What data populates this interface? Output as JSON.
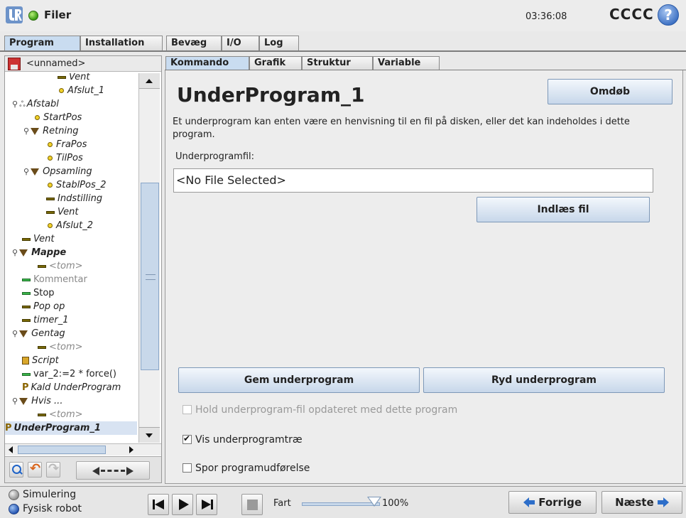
{
  "titlebar": {
    "app_title": "Filer",
    "clock": "03:36:08",
    "robot_name": "CCCC",
    "help_symbol": "?"
  },
  "top_tabs": [
    "Program",
    "Installation",
    "Bevæg",
    "I/O",
    "Log"
  ],
  "program_name": "<unnamed>",
  "tree": [
    {
      "label": "Vent",
      "glyph": "dash"
    },
    {
      "label": "Afslut_1",
      "glyph": "dot"
    },
    {
      "label": "Afstabl",
      "glyph": "stack"
    },
    {
      "label": "StartPos",
      "glyph": "dot"
    },
    {
      "label": "Retning",
      "glyph": "tri"
    },
    {
      "label": "FraPos",
      "glyph": "dot"
    },
    {
      "label": "TilPos",
      "glyph": "dot"
    },
    {
      "label": "Opsamling",
      "glyph": "tri"
    },
    {
      "label": "StablPos_2",
      "glyph": "dot"
    },
    {
      "label": "Indstilling",
      "glyph": "dash"
    },
    {
      "label": "Vent",
      "glyph": "dash"
    },
    {
      "label": "Afslut_2",
      "glyph": "dot"
    },
    {
      "label": "Vent",
      "glyph": "dash"
    },
    {
      "label": "Mappe",
      "glyph": "tri"
    },
    {
      "label": "<tom>",
      "glyph": "dash"
    },
    {
      "label": "Kommentar",
      "glyph": "dash"
    },
    {
      "label": "Stop",
      "glyph": "dash"
    },
    {
      "label": "Pop op",
      "glyph": "dash"
    },
    {
      "label": "timer_1",
      "glyph": "dash"
    },
    {
      "label": "Gentag",
      "glyph": "tri"
    },
    {
      "label": "<tom>",
      "glyph": "dash"
    },
    {
      "label": "Script",
      "glyph": "box"
    },
    {
      "label": "var_2:=2 * force()",
      "glyph": "dash"
    },
    {
      "label": "Kald UnderProgram",
      "glyph": "p"
    },
    {
      "label": "Hvis ...",
      "glyph": "tri"
    },
    {
      "label": "<tom>",
      "glyph": "dash"
    },
    {
      "label": "UnderProgram_1",
      "glyph": "p"
    }
  ],
  "sub_tabs": [
    "Kommando",
    "Grafik",
    "Struktur",
    "Variable"
  ],
  "main": {
    "title": "UnderProgram_1",
    "rename_label": "Omdøb",
    "description": "Et underprogram kan enten være en henvisning til en fil på disken, eller det kan indeholdes i dette program.",
    "file_label": "Underprogramfil:",
    "file_value": "<No File Selected>",
    "load_label": "Indlæs fil",
    "save_label": "Gem underprogram",
    "clear_label": "Ryd underprogram",
    "keep_updated_label": "Hold underprogram-fil opdateret med dette program",
    "keep_updated_checked": false,
    "show_tree_label": "Vis underprogramtræ",
    "show_tree_checked": true,
    "trace_label": "Spor programudførelse",
    "trace_checked": false
  },
  "footer": {
    "simulation_label": "Simulering",
    "real_robot_label": "Fysisk robot",
    "speed_label": "Fart",
    "speed_value": "100%",
    "speed_fraction": 1.0,
    "prev_label": "Forrige",
    "next_label": "Næste"
  },
  "icons": [
    "ur-logo",
    "status-dot-icon",
    "help-icon",
    "save-icon",
    "magnifier-icon",
    "undo-icon",
    "redo-icon",
    "skip-back-icon",
    "play-icon",
    "step-icon",
    "stop-icon",
    "arrow-left-icon",
    "arrow-right-icon"
  ],
  "colors": {
    "accent_tab": "#c9dcf0",
    "button_border": "#7d98b8",
    "status_green": "#3a9a12",
    "help_blue": "#3b6fc2"
  }
}
